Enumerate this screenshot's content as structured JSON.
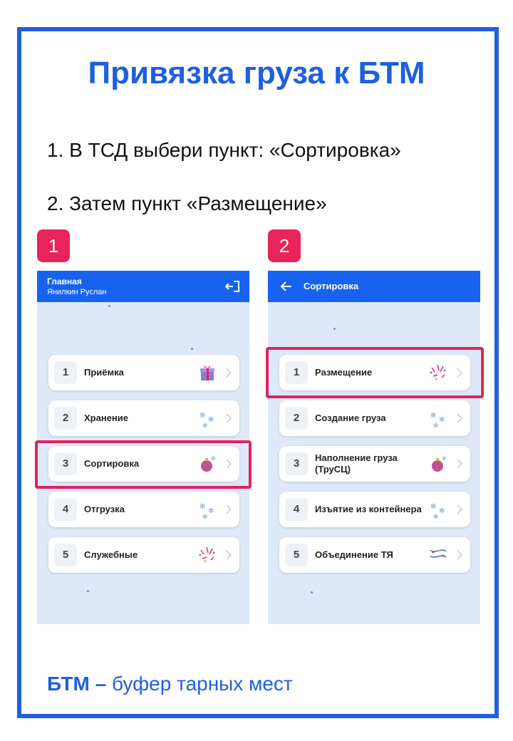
{
  "title": "Привязка груза к БТМ",
  "steps": [
    "1. В ТСД выбери пункт: «Сортировка»",
    "2. Затем пункт «Размещение»"
  ],
  "badges": [
    "1",
    "2"
  ],
  "screen1": {
    "header_title": "Главная",
    "header_user": "Янилкин Руслан",
    "items": [
      {
        "num": "1",
        "label": "Приёмка"
      },
      {
        "num": "2",
        "label": "Хранение"
      },
      {
        "num": "3",
        "label": "Сортировка"
      },
      {
        "num": "4",
        "label": "Отгрузка"
      },
      {
        "num": "5",
        "label": "Служебные"
      }
    ]
  },
  "screen2": {
    "header_title": "Сортировка",
    "items": [
      {
        "num": "1",
        "label": "Размещение"
      },
      {
        "num": "2",
        "label": "Создание груза"
      },
      {
        "num": "3",
        "label": "Наполнение груза (ТруСЦ)"
      },
      {
        "num": "4",
        "label": "Изъятие из контейнера"
      },
      {
        "num": "5",
        "label": "Объединение ТЯ"
      }
    ]
  },
  "footer": {
    "abbr": "БТМ –",
    "meaning": "буфер тарных мест"
  },
  "colors": {
    "accent": "#1f5fe0",
    "appbar": "#1763f0",
    "highlight": "#e0245a",
    "screen_bg": "#dde9f8"
  }
}
